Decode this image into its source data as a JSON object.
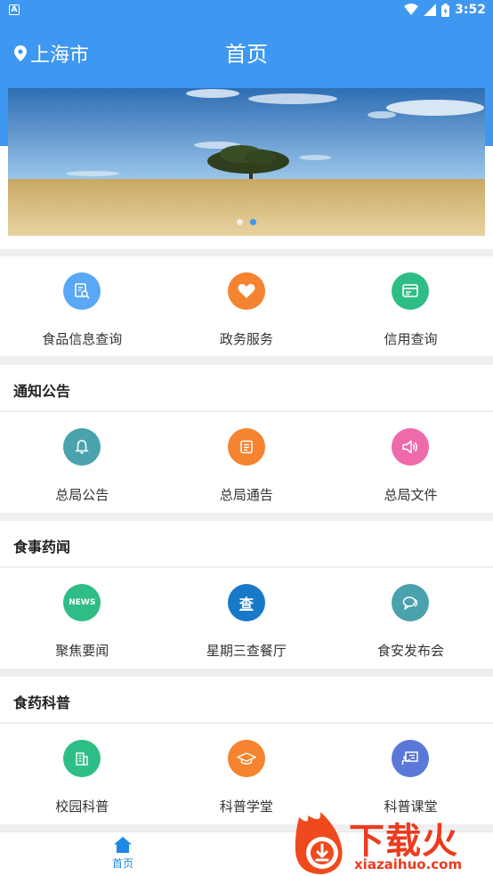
{
  "status_bar": {
    "time": "3:52",
    "notification_icon": "A"
  },
  "header": {
    "location": "上海市",
    "title": "首页"
  },
  "banner": {
    "slide_count": 2,
    "active_slide": 2
  },
  "quick_services": [
    {
      "label": "食品信息查询",
      "icon": "document-search-icon",
      "color": "#5aa7f5"
    },
    {
      "label": "政务服务",
      "icon": "heart-icon",
      "color": "#f5832f"
    },
    {
      "label": "信用查询",
      "icon": "credit-card-icon",
      "color": "#2fbd86"
    }
  ],
  "sections": [
    {
      "title": "通知公告",
      "items": [
        {
          "label": "总局公告",
          "icon": "bell-icon",
          "color": "#4aa3ac"
        },
        {
          "label": "总局通告",
          "icon": "notice-icon",
          "color": "#f5832f"
        },
        {
          "label": "总局文件",
          "icon": "speaker-icon",
          "color": "#ef6aab"
        }
      ]
    },
    {
      "title": "食事药闻",
      "items": [
        {
          "label": "聚焦要闻",
          "icon": "news-icon",
          "icon_text": "NEWS",
          "color": "#2fbd86"
        },
        {
          "label": "星期三查餐厅",
          "icon": "inspect-icon",
          "icon_text": "查",
          "color": "#1879c8"
        },
        {
          "label": "食安发布会",
          "icon": "chat-icon",
          "color": "#4aa3ac"
        }
      ]
    },
    {
      "title": "食药科普",
      "items": [
        {
          "label": "校园科普",
          "icon": "building-icon",
          "color": "#2fbd86"
        },
        {
          "label": "科普学堂",
          "icon": "graduation-cap-icon",
          "color": "#f5832f"
        },
        {
          "label": "科普课堂",
          "icon": "classroom-icon",
          "color": "#5a78d8"
        }
      ]
    }
  ],
  "tabbar": {
    "home_label": "首页"
  },
  "watermark": {
    "cn": "下载火",
    "en": "xiazaihuo.com"
  },
  "colors": {
    "primary": "#3e97f0",
    "background": "#efefef"
  }
}
